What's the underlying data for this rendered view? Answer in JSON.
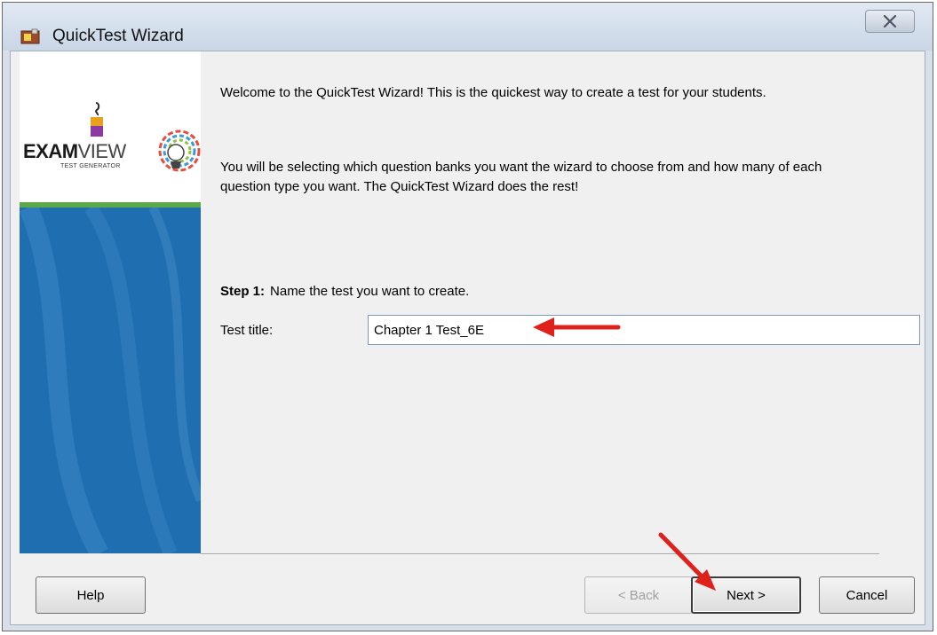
{
  "window": {
    "title": "QuickTest Wizard",
    "close_glyph": "✕"
  },
  "logo": {
    "brand_bold": "EXAM",
    "brand_thin": "VIEW",
    "tagline": "TEST GENERATOR"
  },
  "intro": {
    "welcome": "Welcome to the QuickTest Wizard!  This is the quickest way to create a test for your students.",
    "description": "You will be selecting which question banks you want the wizard to choose from and how many of each question type you want.  The QuickTest Wizard does the rest!"
  },
  "step": {
    "number": "Step 1:",
    "instruction": "Name the test you want to create."
  },
  "form": {
    "test_title_label": "Test title:",
    "test_title_value": "Chapter 1 Test_6E"
  },
  "buttons": {
    "help": "Help",
    "back": "< Back",
    "next": "Next >",
    "cancel": "Cancel"
  },
  "colors": {
    "annotation_arrow": "#e0201b",
    "sidebar_blue": "#1f6fb0",
    "sidebar_green": "#5da84a"
  },
  "icons": {
    "app": "quicktest-app-icon",
    "close": "close-icon",
    "annotation": "red-arrow-icon"
  }
}
